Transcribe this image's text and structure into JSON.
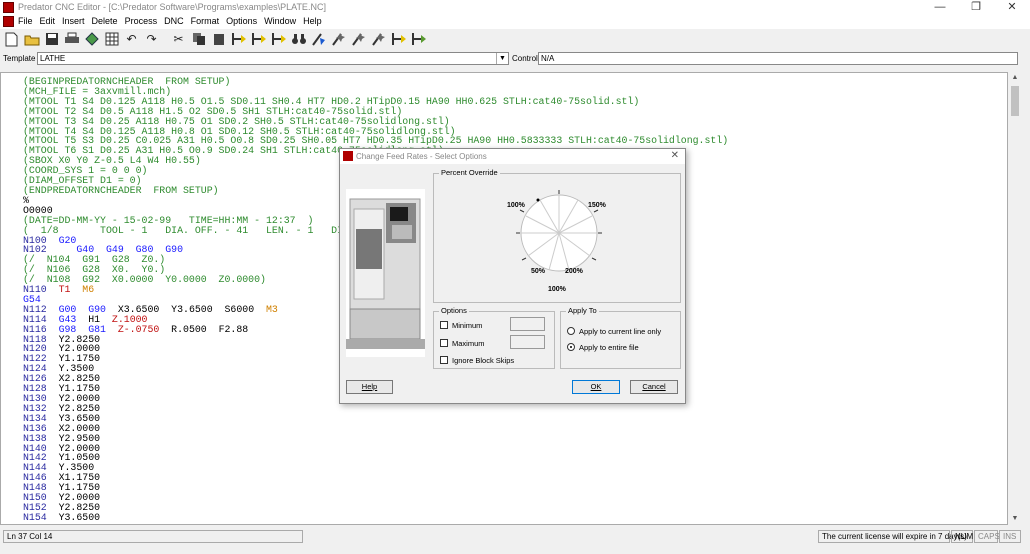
{
  "window": {
    "title": "Predator CNC Editor - [C:\\Predator Software\\Programs\\examples\\PLATE.NC]",
    "controls": [
      "—",
      "❐",
      "✕"
    ]
  },
  "menu": [
    "File",
    "Edit",
    "Insert",
    "Delete",
    "Process",
    "DNC",
    "Format",
    "Options",
    "Window",
    "Help"
  ],
  "toolbar_icons": [
    "new-file-icon",
    "open-folder-icon",
    "save-icon",
    "print-icon",
    "diamond-icon",
    "grid-icon",
    "undo-icon",
    "redo-icon",
    "cut-icon",
    "copy-icon",
    "paste-icon",
    "find-icon",
    "replace-icon",
    "find-next-icon",
    "binoculars-icon",
    "renumber-icon",
    "insert-icon",
    "delete-icon",
    "process-icon",
    "dnc-icon",
    "flag-icon"
  ],
  "template_bar": {
    "template_label": "Template",
    "template_value": "LATHE",
    "control_label": "Control",
    "control_value": "N/A"
  },
  "colors": {
    "comment": "#2e8b2e",
    "line_number": "#2a2aa0",
    "gcode": "#1a1aff",
    "negative": "#c01010",
    "mcode": "#d08000"
  },
  "code_lines": [
    [
      [
        "g",
        "(BEGINPREDATORNCHEADER  FROM SETUP)"
      ]
    ],
    [
      [
        "g",
        "(MCH_FILE = 3axvmill.mch)"
      ]
    ],
    [
      [
        "g",
        "(MTOOL T1 S4 D0.125 A118 H0.5 O1.5 SD0.11 SH0.4 HT7 HD0.2 HTipD0.15 HA90 HH0.625 STLH:cat40-75solid.stl)"
      ]
    ],
    [
      [
        "g",
        "(MTOOL T2 S4 D0.5 A118 H1.5 O2 SD0.5 SH1 STLH:cat40-75solid.stl)"
      ]
    ],
    [
      [
        "g",
        "(MTOOL T3 S4 D0.25 A118 H0.75 O1 SD0.2 SH0.5 STLH:cat40-75solidlong.stl)"
      ]
    ],
    [
      [
        "g",
        "(MTOOL T4 S4 D0.125 A118 H0.8 O1 SD0.12 SH0.5 STLH:cat40-75solidlong.stl)"
      ]
    ],
    [
      [
        "g",
        "(MTOOL T5 S3 D0.25 C0.025 A31 H0.5 O0.8 SD0.25 SH0.05 HT7 HD0.35 HTipD0.25 HA90 HH0.5833333 STLH:cat40-75solidlong.stl)"
      ]
    ],
    [
      [
        "g",
        "(MTOOL T6 S1 D0.25 A31 H0.5 O0.9 SD0.24 SH1 STLH:cat40-75solidlong.stl)"
      ]
    ],
    [
      [
        "g",
        "(SBOX X0 Y0 Z-0.5 L4 W4 H0.55)"
      ]
    ],
    [
      [
        "g",
        "(COORD_SYS 1 = 0 0 0)"
      ]
    ],
    [
      [
        "g",
        "(DIAM_OFFSET D1 = 0)"
      ]
    ],
    [
      [
        "g",
        "(ENDPREDATORNCHEADER  FROM SETUP)"
      ]
    ],
    [
      [
        "k",
        "%"
      ]
    ],
    [
      [
        "k",
        "O0000"
      ]
    ],
    [
      [
        "g",
        "(DATE=DD-MM-YY - 15-02-99   TIME=HH:MM - 12:37  )"
      ]
    ],
    [
      [
        "g",
        "(  1/8       TOOL - 1   DIA. OFF. - 41   LEN. - 1   DIA. - .125 )"
      ]
    ],
    [
      [
        "n",
        "N100  "
      ],
      [
        "b",
        "G20"
      ]
    ],
    [
      [
        "n",
        "N102  "
      ],
      [
        "b",
        "   G40  G49  G80  G90"
      ]
    ],
    [
      [
        "g",
        "(/  N104  G91  G28  Z0.)"
      ]
    ],
    [
      [
        "g",
        "(/  N106  G28  X0.  Y0.)"
      ]
    ],
    [
      [
        "g",
        "(/  N108  G92  X0.0000  Y0.0000  Z0.0000)"
      ]
    ],
    [
      [
        "n",
        "N110  "
      ],
      [
        "r",
        "T1  "
      ],
      [
        "o",
        "M6"
      ]
    ],
    [
      [
        "b",
        "G54"
      ]
    ],
    [
      [
        "n",
        "N112  "
      ],
      [
        "b",
        "G00  G90  "
      ],
      [
        "k",
        "X3.6500  Y3.6500  S6000  "
      ],
      [
        "o",
        "M3"
      ]
    ],
    [
      [
        "n",
        "N114  "
      ],
      [
        "b",
        "G43  "
      ],
      [
        "k",
        "H1  "
      ],
      [
        "r",
        "Z.1000"
      ]
    ],
    [
      [
        "n",
        "N116  "
      ],
      [
        "b",
        "G98  G81  "
      ],
      [
        "r",
        "Z-.0750  "
      ],
      [
        "k",
        "R.0500  F2.88"
      ]
    ],
    [
      [
        "n",
        "N118  "
      ],
      [
        "k",
        "Y2.8250"
      ]
    ],
    [
      [
        "n",
        "N120  "
      ],
      [
        "k",
        "Y2.0000"
      ]
    ],
    [
      [
        "n",
        "N122  "
      ],
      [
        "k",
        "Y1.1750"
      ]
    ],
    [
      [
        "n",
        "N124  "
      ],
      [
        "k",
        "Y.3500"
      ]
    ],
    [
      [
        "n",
        "N126  "
      ],
      [
        "k",
        "X2.8250"
      ]
    ],
    [
      [
        "n",
        "N128  "
      ],
      [
        "k",
        "Y1.1750"
      ]
    ],
    [
      [
        "n",
        "N130  "
      ],
      [
        "k",
        "Y2.0000"
      ]
    ],
    [
      [
        "n",
        "N132  "
      ],
      [
        "k",
        "Y2.8250"
      ]
    ],
    [
      [
        "n",
        "N134  "
      ],
      [
        "k",
        "Y3.6500"
      ]
    ],
    [
      [
        "n",
        "N136  "
      ],
      [
        "k",
        "X2.0000"
      ]
    ],
    [
      [
        "n",
        "N138  "
      ],
      [
        "k",
        "Y2.9500"
      ]
    ],
    [
      [
        "n",
        "N140  "
      ],
      [
        "k",
        "Y2.0000"
      ]
    ],
    [
      [
        "n",
        "N142  "
      ],
      [
        "k",
        "Y1.0500"
      ]
    ],
    [
      [
        "n",
        "N144  "
      ],
      [
        "k",
        "Y.3500"
      ]
    ],
    [
      [
        "n",
        "N146  "
      ],
      [
        "k",
        "X1.1750"
      ]
    ],
    [
      [
        "n",
        "N148  "
      ],
      [
        "k",
        "Y1.1750"
      ]
    ],
    [
      [
        "n",
        "N150  "
      ],
      [
        "k",
        "Y2.0000"
      ]
    ],
    [
      [
        "n",
        "N152  "
      ],
      [
        "k",
        "Y2.8250"
      ]
    ],
    [
      [
        "n",
        "N154  "
      ],
      [
        "k",
        "Y3.6500"
      ]
    ]
  ],
  "status": {
    "position": "Ln 37 Col 14",
    "license": "The current license will expire in 7 day(s)",
    "num": "NUM",
    "caps": "CAPS",
    "ins": "INS"
  },
  "dialog": {
    "title": "Change Feed Rates - Select Options",
    "close": "✕",
    "percent_override_label": "Percent Override",
    "dial_labels": [
      "100%",
      "150%",
      "50%",
      "200%",
      "100%"
    ],
    "options_label": "Options",
    "minimum_label": "Minimum",
    "maximum_label": "Maximum",
    "ignore_label": "Ignore Block Skips",
    "apply_to_label": "Apply To",
    "apply_current_label": "Apply to current line only",
    "apply_entire_label": "Apply to entire file",
    "apply_selected": "entire",
    "help_label": "Help",
    "ok_label": "OK",
    "cancel_label": "Cancel"
  }
}
